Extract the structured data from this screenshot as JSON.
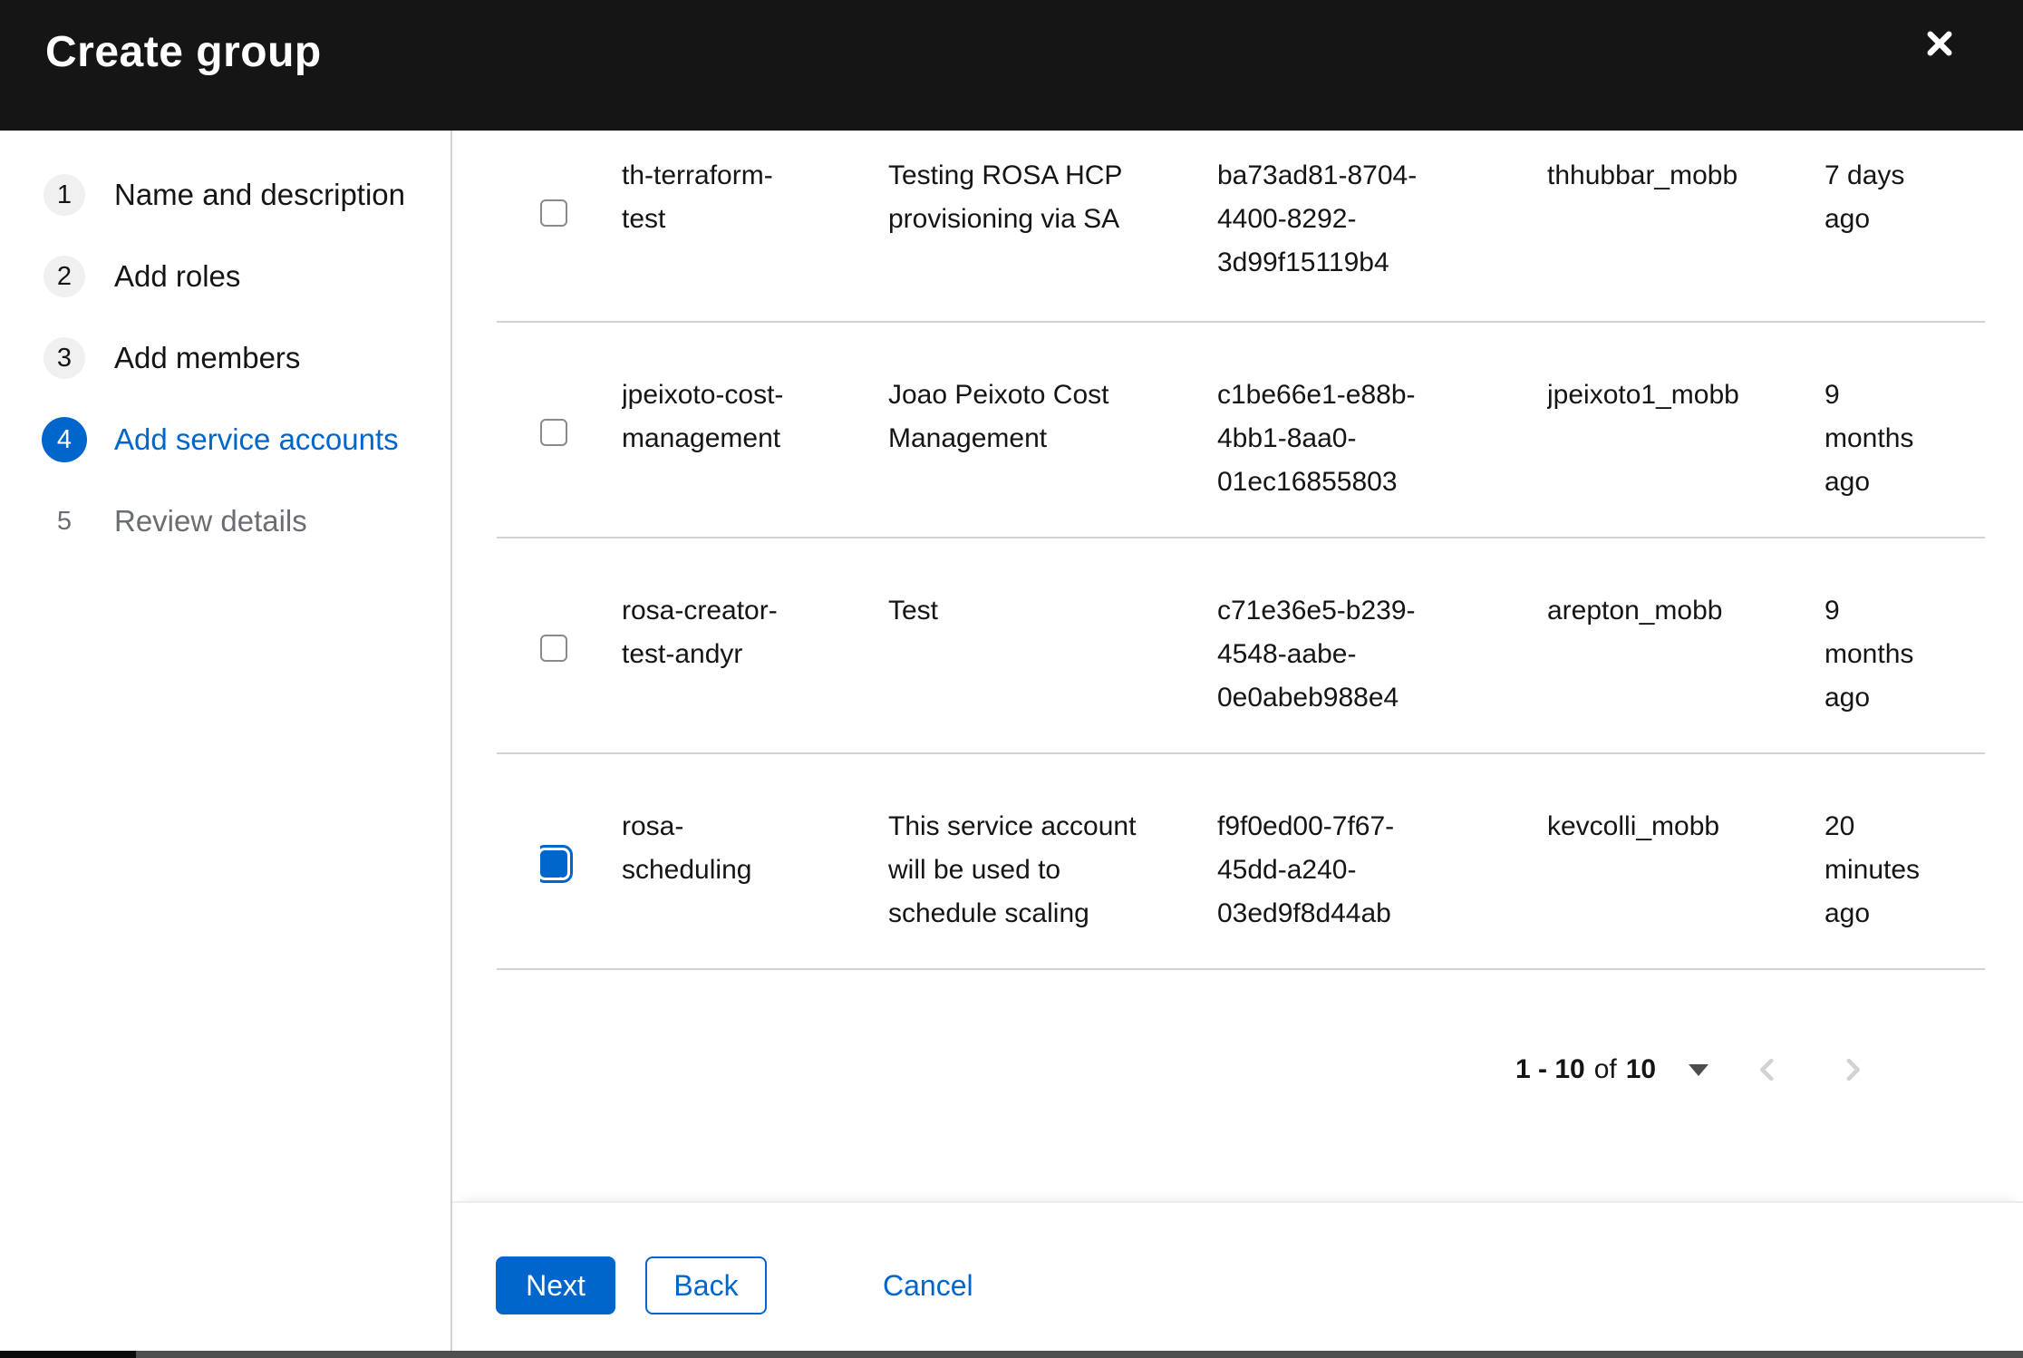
{
  "modal": {
    "title": "Create group"
  },
  "wizard": {
    "steps": [
      {
        "num": "1",
        "label": "Name and description",
        "state": "visited"
      },
      {
        "num": "2",
        "label": "Add roles",
        "state": "visited"
      },
      {
        "num": "3",
        "label": "Add members",
        "state": "visited"
      },
      {
        "num": "4",
        "label": "Add service accounts",
        "state": "current"
      },
      {
        "num": "5",
        "label": "Review details",
        "state": "disabled"
      }
    ]
  },
  "table": {
    "rows": [
      {
        "checked": false,
        "name": "th-terraform-\ntest",
        "description": "Testing ROSA HCP\nprovisioning via SA",
        "client_id": "ba73ad81-8704-\n4400-8292-\n3d99f15119b4",
        "owner": "thhubbar_mobb",
        "created": "7 days\nago"
      },
      {
        "checked": false,
        "name": "jpeixoto-cost-\nmanagement",
        "description": "Joao Peixoto Cost\nManagement",
        "client_id": "c1be66e1-e88b-\n4bb1-8aa0-\n01ec16855803",
        "owner": "jpeixoto1_mobb",
        "created": "9\nmonths\nago"
      },
      {
        "checked": false,
        "name": "rosa-creator-\ntest-andyr",
        "description": "Test",
        "client_id": "c71e36e5-b239-\n4548-aabe-\n0e0abeb988e4",
        "owner": "arepton_mobb",
        "created": "9\nmonths\nago"
      },
      {
        "checked": true,
        "name": "rosa-\nscheduling",
        "description": "This service account\nwill be used to\nschedule scaling",
        "client_id": "f9f0ed00-7f67-\n45dd-a240-\n03ed9f8d44ab",
        "owner": "kevcolli_mobb",
        "created": "20\nminutes\nago"
      }
    ]
  },
  "pagination": {
    "range": "1 - 10",
    "of_label": "of",
    "total": "10"
  },
  "footer": {
    "next_label": "Next",
    "back_label": "Back",
    "cancel_label": "Cancel"
  },
  "colors": {
    "accent": "#0066cc",
    "header_bg": "#151515",
    "text": "#151515",
    "muted_text": "#6a6e73",
    "border": "#d2d2d2",
    "disabled_icon": "#d2d2d2"
  }
}
